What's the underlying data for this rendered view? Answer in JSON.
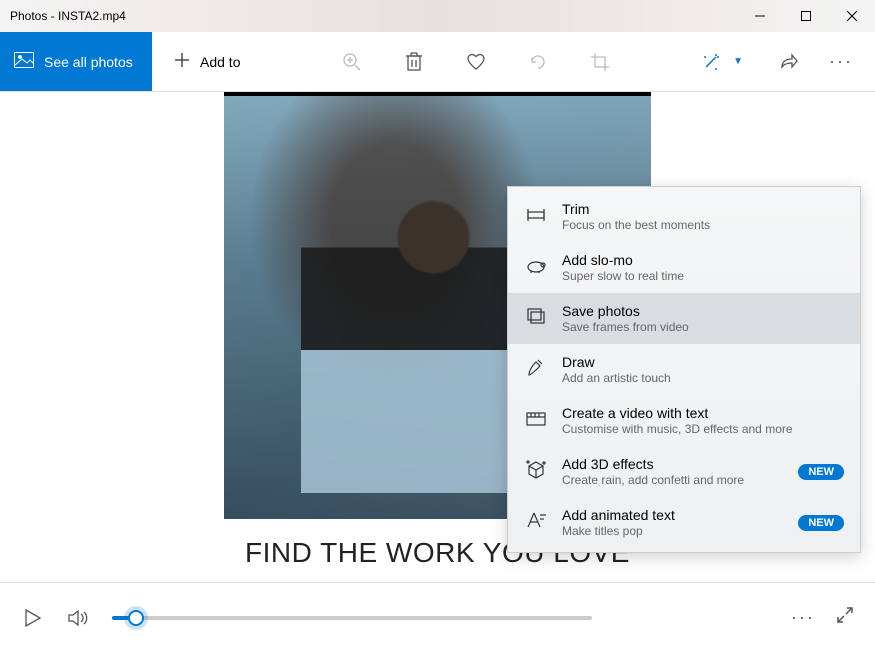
{
  "window": {
    "title": "Photos - INSTA2.mp4"
  },
  "toolbar": {
    "see_all_label": "See all photos",
    "add_to_label": "Add to"
  },
  "caption": "FIND THE WORK YOU LOVE",
  "dropdown": {
    "items": [
      {
        "title": "Trim",
        "subtitle": "Focus on the best moments",
        "badge": null
      },
      {
        "title": "Add slo-mo",
        "subtitle": "Super slow to real time",
        "badge": null
      },
      {
        "title": "Save photos",
        "subtitle": "Save frames from video",
        "badge": null
      },
      {
        "title": "Draw",
        "subtitle": "Add an artistic touch",
        "badge": null
      },
      {
        "title": "Create a video with text",
        "subtitle": "Customise with music, 3D effects and more",
        "badge": null
      },
      {
        "title": "Add 3D effects",
        "subtitle": "Create rain, add confetti and more",
        "badge": "NEW"
      },
      {
        "title": "Add animated text",
        "subtitle": "Make titles pop",
        "badge": "NEW"
      }
    ]
  },
  "playback": {
    "position_pct": 5
  }
}
